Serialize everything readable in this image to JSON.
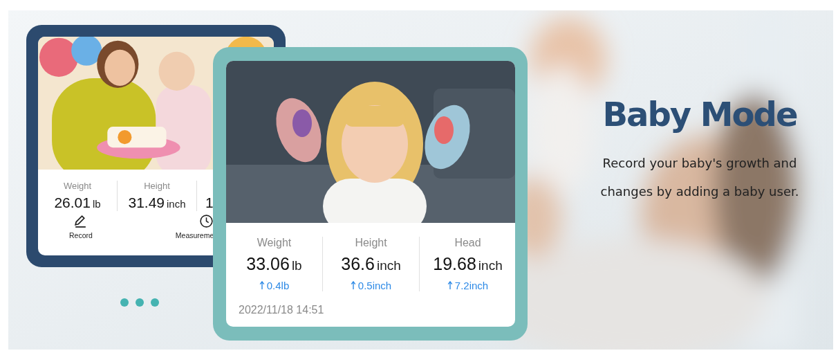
{
  "banner": {
    "title": "Baby Mode",
    "description": "Record your baby's growth and changes by adding a baby user."
  },
  "back_card": {
    "stats": [
      {
        "label": "Weight",
        "value": "26.01",
        "unit": "lb"
      },
      {
        "label": "Height",
        "value": "31.49",
        "unit": "inch"
      },
      {
        "value": "1"
      }
    ],
    "actions": [
      {
        "kind": "record",
        "label": "Record"
      },
      {
        "kind": "clock",
        "label": "Measureme"
      }
    ]
  },
  "front_card": {
    "stats": [
      {
        "label": "Weight",
        "value": "33.06",
        "unit": "lb",
        "change": "0.4lb"
      },
      {
        "label": "Height",
        "value": "36.6",
        "unit": "inch",
        "change": "0.5inch"
      },
      {
        "label": "Head",
        "value": "19.68",
        "unit": "inch",
        "change": "7.2inch"
      }
    ],
    "date": "2022/11/18 14:51"
  },
  "carousel_dots": [
    {
      "selected": false
    },
    {
      "selected": false
    },
    {
      "selected": false
    }
  ]
}
